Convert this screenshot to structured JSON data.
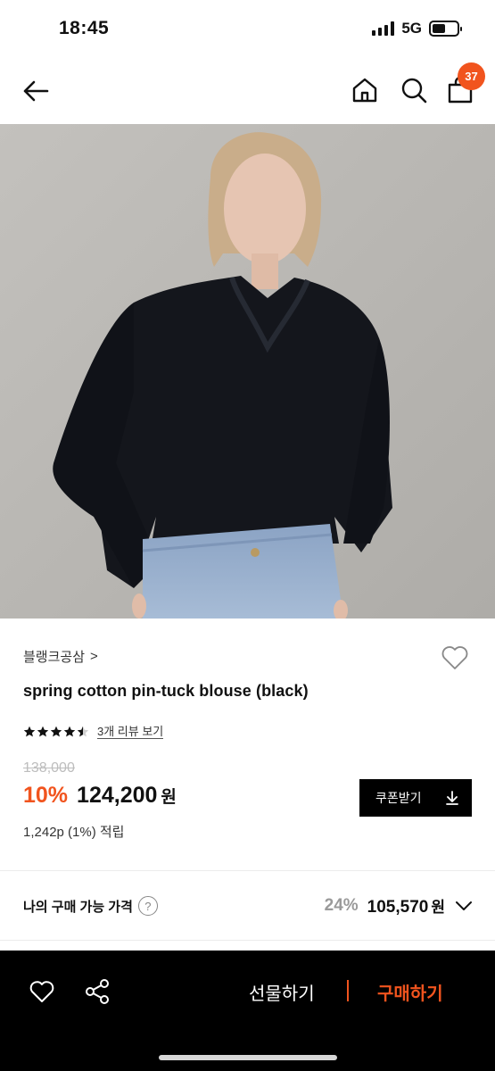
{
  "status_bar": {
    "time": "18:45",
    "network": "5G",
    "battery_level": 0.55
  },
  "header": {
    "cart_badge": "37",
    "icons": [
      "back-arrow-icon",
      "home-icon",
      "search-icon",
      "shopping-bag-icon"
    ]
  },
  "product": {
    "brand": "블랭크공삼",
    "brand_chevron": ">",
    "title": "spring cotton pin-tuck blouse (black)",
    "rating": 4.5,
    "review_link": "3개 리뷰 보기",
    "original_price": "138,000",
    "discount_rate": "10%",
    "sale_price": "124,200",
    "currency": "원",
    "coupon_label": "쿠폰받기",
    "points": "1,242p (1%) 적립"
  },
  "my_price": {
    "label": "나의 구매 가능 가격",
    "help": "?",
    "discount": "24%",
    "price": "105,570",
    "currency": "원"
  },
  "bottom_bar": {
    "gift_label": "선물하기",
    "buy_label": "구매하기"
  },
  "colors": {
    "accent": "#f1541e",
    "dark": "#000000",
    "muted": "#bdbdbd"
  }
}
